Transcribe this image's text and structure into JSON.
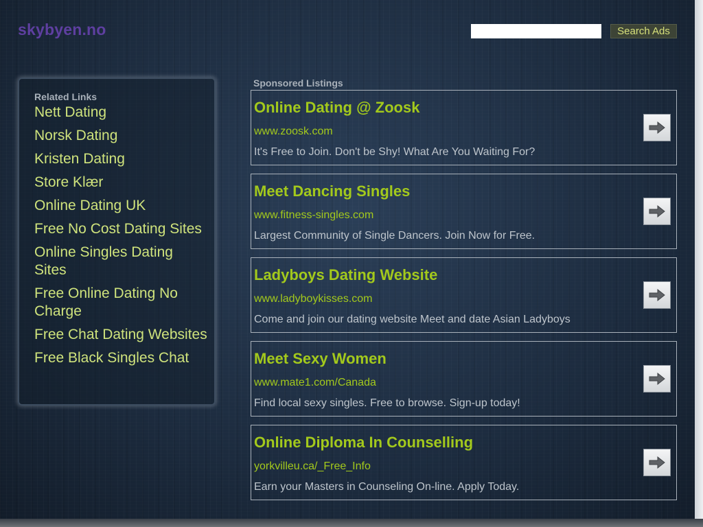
{
  "site": {
    "logo": "skybyen.no"
  },
  "search": {
    "value": "",
    "placeholder": "",
    "button_label": "Search Ads"
  },
  "related": {
    "heading": "Related Links",
    "items": [
      {
        "label": "Nett Dating"
      },
      {
        "label": "Norsk Dating"
      },
      {
        "label": "Kristen Dating"
      },
      {
        "label": "Store Klær"
      },
      {
        "label": "Online Dating UK"
      },
      {
        "label": "Free No Cost Dating Sites"
      },
      {
        "label": "Online Singles Dating Sites"
      },
      {
        "label": "Free Online Dating No Charge"
      },
      {
        "label": "Free Chat Dating Websites"
      },
      {
        "label": "Free Black Singles Chat"
      }
    ]
  },
  "sponsored": {
    "heading": "Sponsored Listings",
    "ads": [
      {
        "title": "Online Dating @ Zoosk",
        "url": "www.zoosk.com",
        "description": "It's Free to Join. Don't be Shy! What Are You Waiting For?",
        "icon": "arrow-right-icon"
      },
      {
        "title": "Meet Dancing Singles",
        "url": "www.fitness-singles.com",
        "description": "Largest Community of Single Dancers. Join Now for Free.",
        "icon": "arrow-right-icon"
      },
      {
        "title": "Ladyboys Dating Website",
        "url": "www.ladyboykisses.com",
        "description": "Come and join our dating website Meet and date Asian Ladyboys",
        "icon": "arrow-right-icon"
      },
      {
        "title": "Meet Sexy Women",
        "url": "www.mate1.com/Canada",
        "description": "Find local sexy singles. Free to browse. Sign-up today!",
        "icon": "arrow-right-icon"
      },
      {
        "title": "Online Diploma In Counselling",
        "url": "yorkvilleu.ca/_Free_Info",
        "description": "Earn your Masters in Counseling On-line. Apply Today.",
        "icon": "arrow-right-icon"
      }
    ]
  },
  "colors": {
    "logo": "#5e3fa0",
    "link": "#cfe37c",
    "ad_title": "#a3c91c",
    "ad_text": "#bec5cc",
    "background": "#1f3046"
  }
}
